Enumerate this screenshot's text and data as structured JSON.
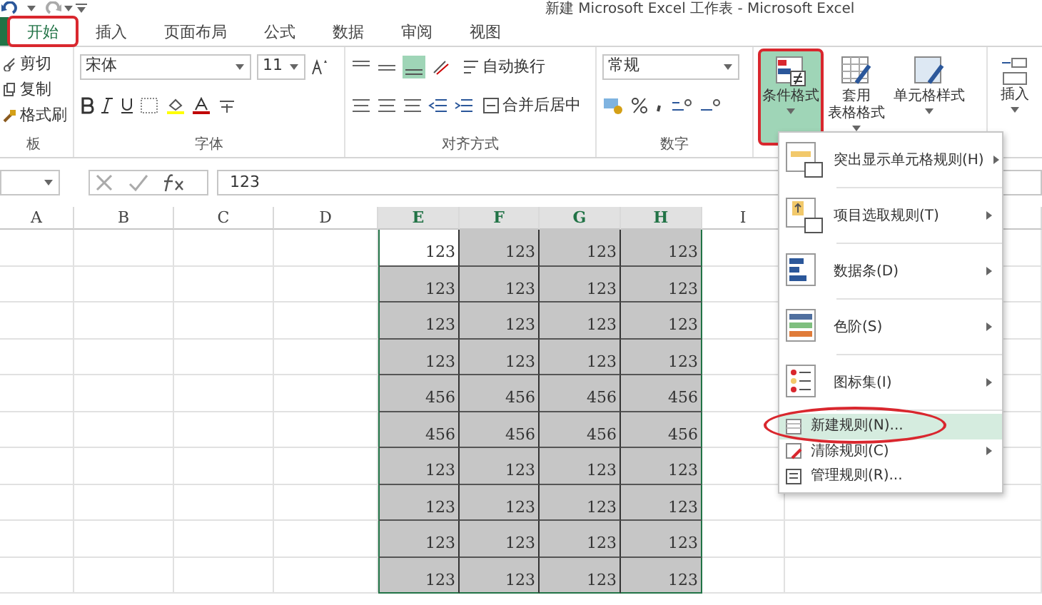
{
  "window": {
    "title": "新建 Microsoft Excel 工作表 - Microsoft Excel"
  },
  "tabs": [
    {
      "label": "开始",
      "selected": true,
      "annotated": true
    },
    {
      "label": "插入",
      "selected": false,
      "annotated": false
    },
    {
      "label": "页面布局",
      "selected": false,
      "annotated": false
    },
    {
      "label": "公式",
      "selected": false,
      "annotated": false
    },
    {
      "label": "数据",
      "selected": false,
      "annotated": false
    },
    {
      "label": "审阅",
      "selected": false,
      "annotated": false
    },
    {
      "label": "视图",
      "selected": false,
      "annotated": false
    }
  ],
  "ribbon": {
    "clipboard": {
      "items": [
        "剪切",
        "复制",
        "格式刷"
      ],
      "group_label": "板"
    },
    "font": {
      "font_name": "宋体",
      "font_size": "11",
      "group_label": "字体"
    },
    "alignment": {
      "wrap_text": "自动换行",
      "merge_center": "合并后居中",
      "group_label": "对齐方式"
    },
    "number": {
      "format": "常规",
      "group_label": "数字"
    },
    "styles": [
      {
        "lines": [
          "条件格式"
        ],
        "selected": true,
        "annotated": true
      },
      {
        "lines": [
          "套用",
          "表格格式"
        ],
        "selected": false,
        "annotated": false
      },
      {
        "lines": [
          "单元格样式"
        ],
        "selected": false,
        "annotated": false
      }
    ],
    "cells": {
      "insert": "插入"
    }
  },
  "formula_bar": {
    "value": "123"
  },
  "columns": [
    {
      "label": "A",
      "selected": false
    },
    {
      "label": "B",
      "selected": false
    },
    {
      "label": "C",
      "selected": false
    },
    {
      "label": "D",
      "selected": false
    },
    {
      "label": "E",
      "selected": true
    },
    {
      "label": "F",
      "selected": true
    },
    {
      "label": "G",
      "selected": true
    },
    {
      "label": "H",
      "selected": true
    },
    {
      "label": "I",
      "selected": false
    }
  ],
  "rows": [
    {
      "cells": [
        {
          "value": "123",
          "active": true
        },
        {
          "value": "123",
          "active": false
        },
        {
          "value": "123",
          "active": false
        },
        {
          "value": "123",
          "active": false
        }
      ]
    },
    {
      "cells": [
        {
          "value": "123",
          "active": false
        },
        {
          "value": "123",
          "active": false
        },
        {
          "value": "123",
          "active": false
        },
        {
          "value": "123",
          "active": false
        }
      ]
    },
    {
      "cells": [
        {
          "value": "123",
          "active": false
        },
        {
          "value": "123",
          "active": false
        },
        {
          "value": "123",
          "active": false
        },
        {
          "value": "123",
          "active": false
        }
      ]
    },
    {
      "cells": [
        {
          "value": "123",
          "active": false
        },
        {
          "value": "123",
          "active": false
        },
        {
          "value": "123",
          "active": false
        },
        {
          "value": "123",
          "active": false
        }
      ]
    },
    {
      "cells": [
        {
          "value": "456",
          "active": false
        },
        {
          "value": "456",
          "active": false
        },
        {
          "value": "456",
          "active": false
        },
        {
          "value": "456",
          "active": false
        }
      ]
    },
    {
      "cells": [
        {
          "value": "456",
          "active": false
        },
        {
          "value": "456",
          "active": false
        },
        {
          "value": "456",
          "active": false
        },
        {
          "value": "456",
          "active": false
        }
      ]
    },
    {
      "cells": [
        {
          "value": "123",
          "active": false
        },
        {
          "value": "123",
          "active": false
        },
        {
          "value": "123",
          "active": false
        },
        {
          "value": "123",
          "active": false
        }
      ]
    },
    {
      "cells": [
        {
          "value": "123",
          "active": false
        },
        {
          "value": "123",
          "active": false
        },
        {
          "value": "123",
          "active": false
        },
        {
          "value": "123",
          "active": false
        }
      ]
    },
    {
      "cells": [
        {
          "value": "123",
          "active": false
        },
        {
          "value": "123",
          "active": false
        },
        {
          "value": "123",
          "active": false
        },
        {
          "value": "123",
          "active": false
        }
      ]
    },
    {
      "cells": [
        {
          "value": "123",
          "active": false
        },
        {
          "value": "123",
          "active": false
        },
        {
          "value": "123",
          "active": false
        },
        {
          "value": "123",
          "active": false
        }
      ]
    }
  ],
  "menu": {
    "items": [
      {
        "label": "突出显示单元格规则(H)",
        "kind": "large",
        "submenu": true,
        "highlighted": false,
        "annotated": false
      },
      {
        "label": "项目选取规则(T)",
        "kind": "large",
        "submenu": true,
        "highlighted": false,
        "annotated": false
      },
      {
        "label": "数据条(D)",
        "kind": "large",
        "submenu": true,
        "highlighted": false,
        "annotated": false
      },
      {
        "label": "色阶(S)",
        "kind": "large",
        "submenu": true,
        "highlighted": false,
        "annotated": false
      },
      {
        "label": "图标集(I)",
        "kind": "large",
        "submenu": true,
        "highlighted": false,
        "annotated": false
      },
      {
        "label": "新建规则(N)...",
        "kind": "small",
        "submenu": false,
        "highlighted": true,
        "annotated": true
      },
      {
        "label": "清除规则(C)",
        "kind": "small",
        "submenu": true,
        "highlighted": false,
        "annotated": false
      },
      {
        "label": "管理规则(R)...",
        "kind": "small",
        "submenu": false,
        "highlighted": false,
        "annotated": false
      }
    ]
  }
}
